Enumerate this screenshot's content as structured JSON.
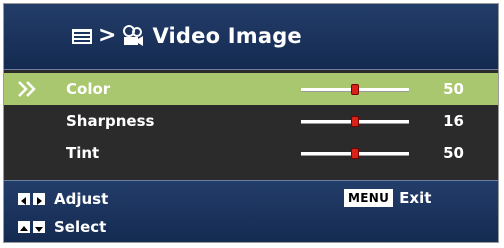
{
  "header": {
    "menu_icon": "menu-list-icon",
    "separator": ">",
    "section_icon": "projector-film-icon",
    "title": "Video Image"
  },
  "rows": [
    {
      "label": "Color",
      "value": "50",
      "level": 0.5,
      "selected": true
    },
    {
      "label": "Sharpness",
      "value": "16",
      "level": 0.5,
      "selected": false
    },
    {
      "label": "Tint",
      "value": "50",
      "level": 0.5,
      "selected": false
    }
  ],
  "footer": {
    "adjust_label": "Adjust",
    "select_label": "Select",
    "menu_key": "MENU",
    "exit_label": "Exit"
  },
  "colors": {
    "header_bg": "#1b345f",
    "body_bg": "#2b2b2b",
    "selected_row": "#a9c76e",
    "knob": "#d8231b",
    "text": "#ffffff"
  }
}
